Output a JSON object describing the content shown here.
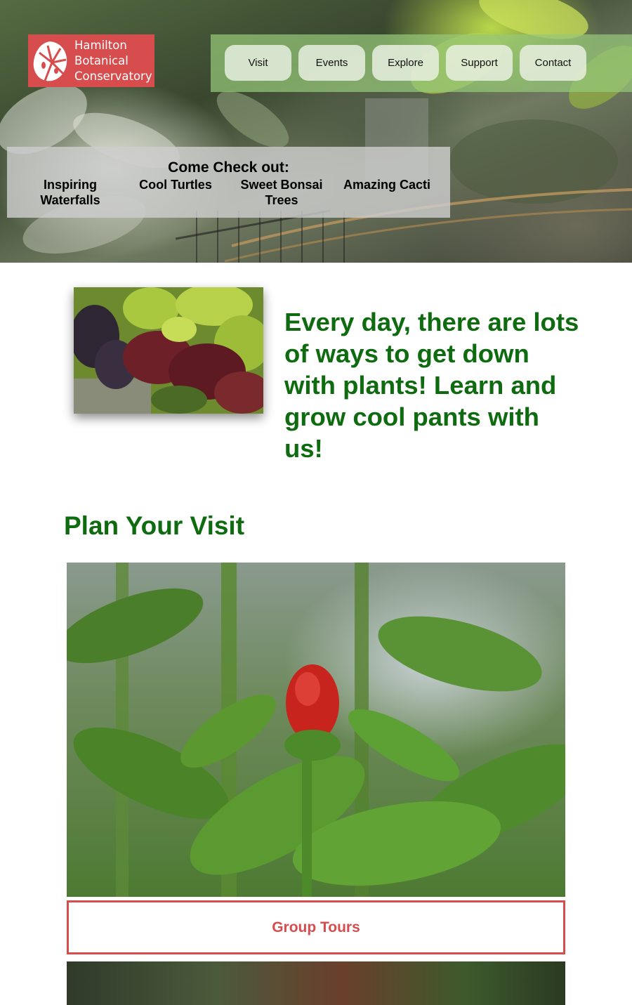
{
  "logo": {
    "line1": "Hamilton",
    "line2": "Botanical",
    "line3": "Conservatory",
    "icon": "monstera-leaf-icon",
    "color": "#d74d4d"
  },
  "nav": {
    "items": [
      {
        "label": "Visit"
      },
      {
        "label": "Events"
      },
      {
        "label": "Explore"
      },
      {
        "label": "Support"
      },
      {
        "label": "Contact"
      }
    ]
  },
  "checkout": {
    "title": "Come Check out:",
    "items": [
      {
        "label": "Inspiring Waterfalls"
      },
      {
        "label": "Cool Turtles"
      },
      {
        "label": "Sweet Bonsai Trees"
      },
      {
        "label": "Amazing Cacti"
      }
    ]
  },
  "intro": {
    "text": "Every day, there are lots of ways to get down with plants! Learn and grow cool pants with us!"
  },
  "plan": {
    "title": "Plan Your Visit",
    "tours_label": "Group Tours"
  },
  "colors": {
    "accent_red": "#d74d4d",
    "heading_green": "#0f6b0f"
  }
}
